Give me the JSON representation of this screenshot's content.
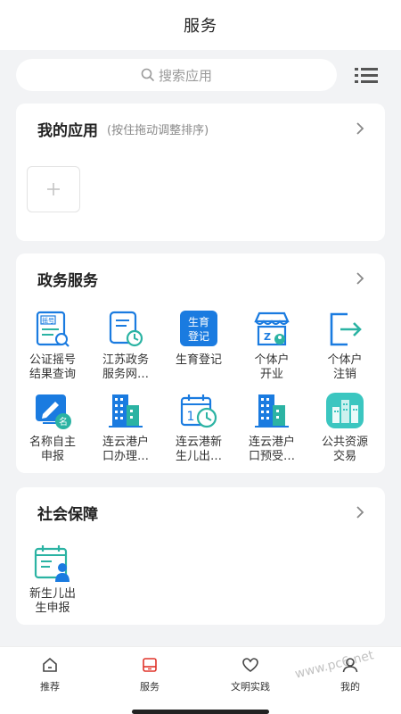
{
  "header": {
    "title": "服务"
  },
  "search": {
    "placeholder": "搜索应用"
  },
  "my_apps": {
    "title": "我的应用",
    "hint": "(按住拖动调整排序)"
  },
  "gov": {
    "title": "政务服务",
    "apps": [
      {
        "label": "公证摇号\n结果查询",
        "icon": "notary-lottery-icon"
      },
      {
        "label": "江苏政务\n服务网…",
        "icon": "document-clock-icon"
      },
      {
        "label": "生育登记",
        "icon": "birth-registration-icon",
        "badge": "生育\n登记"
      },
      {
        "label": "个体户\n开业",
        "icon": "shop-icon"
      },
      {
        "label": "个体户\n注销",
        "icon": "exit-icon"
      },
      {
        "label": "名称自主\n申报",
        "icon": "name-declare-icon"
      },
      {
        "label": "连云港户\n口办理…",
        "icon": "building-icon"
      },
      {
        "label": "连云港新\n生儿出…",
        "icon": "calendar-clock-icon"
      },
      {
        "label": "连云港户\n口预受…",
        "icon": "building-icon"
      },
      {
        "label": "公共资源\n交易",
        "icon": "public-resource-icon"
      }
    ]
  },
  "social": {
    "title": "社会保障",
    "apps": [
      {
        "label": "新生儿出\n生申报",
        "icon": "newborn-calendar-icon"
      }
    ]
  },
  "tabs": [
    {
      "label": "推荐",
      "icon": "home-icon"
    },
    {
      "label": "服务",
      "icon": "service-icon",
      "active": true
    },
    {
      "label": "文明实践",
      "icon": "heart-icon"
    },
    {
      "label": "我的",
      "icon": "user-icon"
    }
  ],
  "watermark": "www.pc6.net",
  "colors": {
    "accent": "#1a7be0",
    "teal": "#2bb3a3",
    "red": "#e0352b"
  }
}
